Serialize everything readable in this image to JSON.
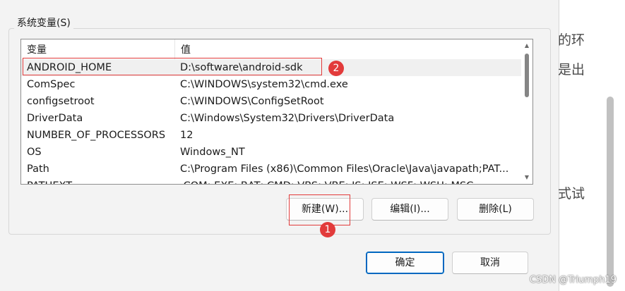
{
  "group": {
    "title": "系统变量(S)"
  },
  "list": {
    "columns": {
      "variable": "变量",
      "value": "值"
    },
    "rows": [
      {
        "name": "ANDROID_HOME",
        "value": "D:\\software\\android-sdk"
      },
      {
        "name": "ComSpec",
        "value": "C:\\WINDOWS\\system32\\cmd.exe"
      },
      {
        "name": "configsetroot",
        "value": "C:\\WINDOWS\\ConfigSetRoot"
      },
      {
        "name": "DriverData",
        "value": "C:\\Windows\\System32\\Drivers\\DriverData"
      },
      {
        "name": "NUMBER_OF_PROCESSORS",
        "value": "12"
      },
      {
        "name": "OS",
        "value": "Windows_NT"
      },
      {
        "name": "Path",
        "value": "C:\\Program Files (x86)\\Common Files\\Oracle\\Java\\javapath;PAT..."
      },
      {
        "name": "PATHEXT",
        "value": ".COM;.EXE;.BAT;.CMD;.VBS;.VBE;.JS;.JSE;.WSF;.WSH;.MSC"
      }
    ],
    "selected_index": 0
  },
  "buttons": {
    "new": "新建(W)...",
    "edit": "编辑(I)...",
    "delete": "删除(L)",
    "ok": "确定",
    "cancel": "取消"
  },
  "annotations": {
    "badge_1": "1",
    "badge_2": "2",
    "color": "#e23b3b"
  },
  "background_text": {
    "line1": "的环",
    "line2": "是出",
    "line3": "式试"
  },
  "watermark": "CSDN @Triumph19",
  "colors": {
    "accent": "#0067c0",
    "dialog_bg": "#f3f3f3",
    "selected_row": "#f0f0f0"
  }
}
